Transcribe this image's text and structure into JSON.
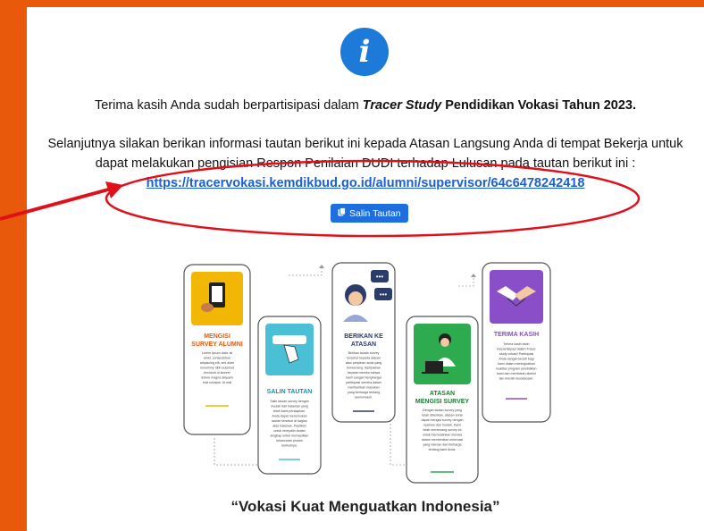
{
  "message": {
    "line1_prefix": "Terima kasih Anda sudah berpartisipasi dalam ",
    "line1_em": "Tracer Study",
    "line1_suffix": " Pendidikan Vokasi Tahun 2023.",
    "para_part1": "Selanjutnya silakan berikan informasi tautan berikut ini kepada Atasan Langsung Anda di tempat Bekerja untuk",
    "para_part2": "dapat melakukan pengisian Respon Penilaian DUDI terhadap Lulusan pada tautan berikut ini :",
    "link": "https://tracervokasi.kemdikbud.go.id/alumni/supervisor/64c6478242418"
  },
  "copy_button": {
    "label": "Salin Tautan"
  },
  "infographic": {
    "steps": [
      {
        "title_lines": [
          "MENGISI",
          "SURVEY ALUMNI"
        ],
        "body": [
          "Lorem ipsum dolor sit",
          "amet, consectetuer",
          "adipiscing elit, sed diam",
          "nonummy nibh euismod",
          "tincidunt ut laoreet",
          "dolore magna aliquam",
          "erat volutpat. Ut wisi"
        ]
      },
      {
        "title_lines": [
          "SALIN TAUTAN"
        ],
        "body": [
          "Salin tautan survey dengan",
          "mudah dari halaman yang",
          "telah kami persiapkan.",
          "Anda dapat menemukan",
          "tautan tersebut di bagian",
          "atas halaman. Pastikan",
          "untuk menyalin tautan",
          "lengkap untuk memastikan",
          "kelancaran proses",
          "berikutnya."
        ]
      },
      {
        "title_lines": [
          "BERIKAN KE",
          "ATASAN"
        ],
        "body": [
          "Berikan tautan survey",
          "tersebut kepada atasan",
          "atau pimpinan anda yang",
          "berwenang. Sampaikan",
          "kepada mereka bahwa",
          "kami sangat menghargai",
          "partisipasi mereka dalam",
          "memberikan masukan",
          "yang berharga tentang",
          "alumni kami."
        ]
      },
      {
        "title_lines": [
          "ATASAN",
          "MENGISI SURVEY"
        ],
        "body": [
          "Dengan tautan survey yang",
          "telah diberikan, atasan anda",
          "dapat mengisi survey dengan",
          "nyaman dan mudah. Kami",
          "telah merancang survey ini",
          "untuk memudahkan mereka",
          "dalam memberikan informasi",
          "yang relevan dan berharga",
          "tentang kami Anda."
        ]
      },
      {
        "title_lines": [
          "TERIMA KASIH"
        ],
        "body": [
          "Terima kasih telah",
          "berpartisipasi dalam Tracer",
          "study vokasi! Partisipasi",
          "Anda sangat berarti bagi",
          "kami dalam meningkatkan",
          "kualitas program pendidikan",
          "kami dan membantu alumni",
          "lain meraih kesuksesan."
        ]
      }
    ]
  },
  "tagline": "“Vokasi Kuat Menguatkan Indonesia”",
  "colors": {
    "accent": "#e8590c",
    "brand_blue": "#1e7ad9",
    "annotation_red": "#e0101a"
  }
}
